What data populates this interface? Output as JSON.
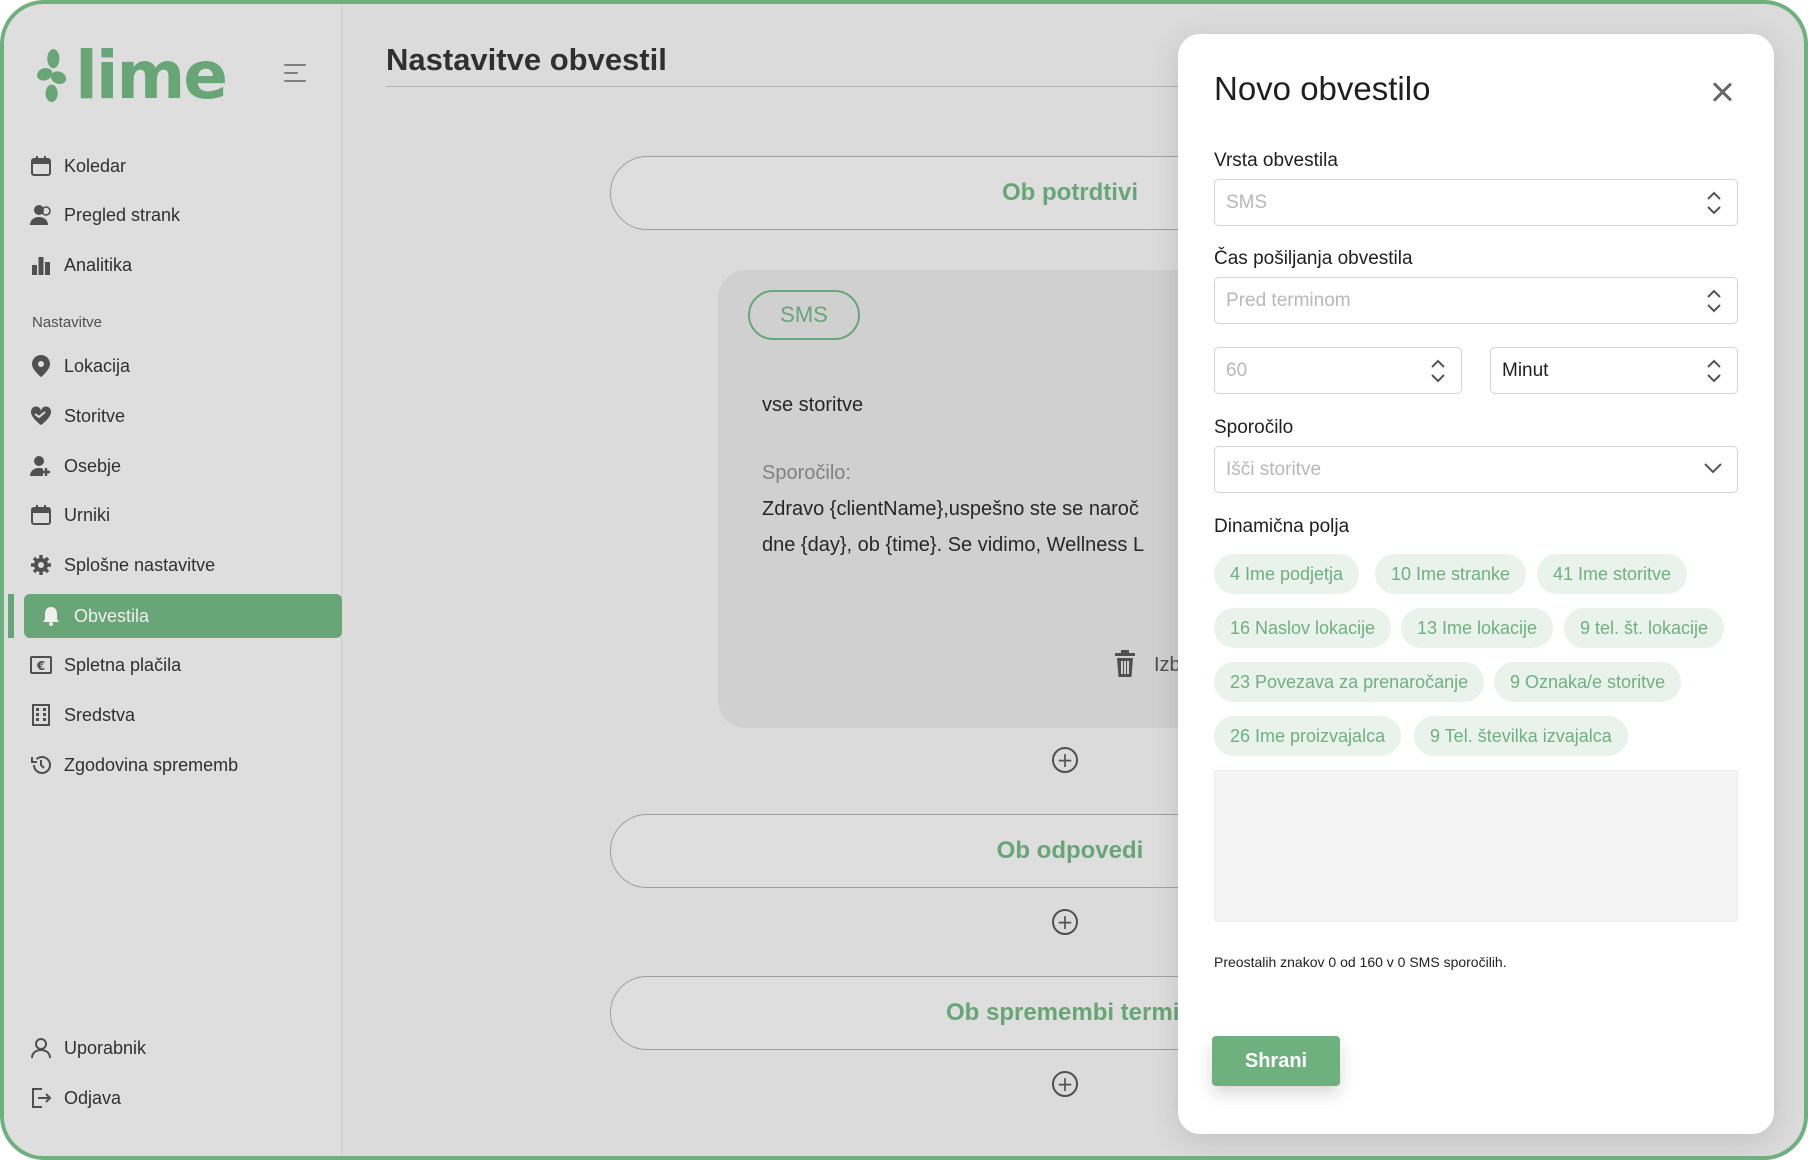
{
  "sidebar": {
    "logo": "lime",
    "items": [
      {
        "label": "Koledar",
        "icon": "calendar-icon"
      },
      {
        "label": "Pregled strank",
        "icon": "users-icon"
      },
      {
        "label": "Analitika",
        "icon": "bar-chart-icon"
      }
    ],
    "section_label": "Nastavitve",
    "settings_items": [
      {
        "label": "Lokacija",
        "icon": "location-pin-icon"
      },
      {
        "label": "Storitve",
        "icon": "heart-hand-icon"
      },
      {
        "label": "Osebje",
        "icon": "user-add-icon"
      },
      {
        "label": "Urniki",
        "icon": "calendar-icon"
      },
      {
        "label": "Splošne nastavitve",
        "icon": "gear-icon"
      },
      {
        "label": "Obvestila",
        "icon": "bell-icon",
        "active": true
      },
      {
        "label": "Spletna plačila",
        "icon": "euro-icon"
      },
      {
        "label": "Sredstva",
        "icon": "building-icon"
      },
      {
        "label": "Zgodovina sprememb",
        "icon": "history-icon"
      }
    ],
    "bottom_items": [
      {
        "label": "Uporabnik",
        "icon": "user-icon"
      },
      {
        "label": "Odjava",
        "icon": "logout-icon"
      }
    ]
  },
  "main": {
    "title": "Nastavitve obvestil",
    "sections": [
      {
        "label": "Ob potrdtivi"
      },
      {
        "label": "Ob odpovedi"
      },
      {
        "label": "Ob spremembi termin"
      }
    ],
    "card": {
      "badge": "SMS",
      "services": "vse storitve",
      "message_label": "Sporočilo:",
      "message_line1": "Zdravo {clientName},uspešno ste se naroč",
      "message_line2": "dne {day}, ob {time}. Se vidimo, Wellness L",
      "delete_label": "Izb"
    }
  },
  "modal": {
    "title": "Novo obvestilo",
    "type_label": "Vrsta obvestila",
    "type_value": "SMS",
    "time_label": "Čas pošiljanja obvestila",
    "time_value": "Pred terminom",
    "amount_value": "60",
    "unit_value": "Minut",
    "message_label": "Sporočilo",
    "message_placeholder": "Išči storitve",
    "dynamic_label": "Dinamična polja",
    "chips": [
      "4 Ime podjetja",
      "10 Ime stranke",
      "41 Ime storitve",
      "16 Naslov lokacije",
      "13 Ime lokacije",
      "9 tel. št. lokacije",
      "23 Povezava za prenaročanje",
      "9 Oznaka/e storitve",
      "26 Ime proizvajalca",
      "9 Tel. številka izvajalca"
    ],
    "counter": "Preostalih znakov 0 od 160 v 0 SMS sporočilih.",
    "save_label": "Shrani"
  },
  "colors": {
    "accent": "#6fb07f",
    "chip_bg": "#eaf2ec",
    "sidebar_bg": "#ececec"
  }
}
